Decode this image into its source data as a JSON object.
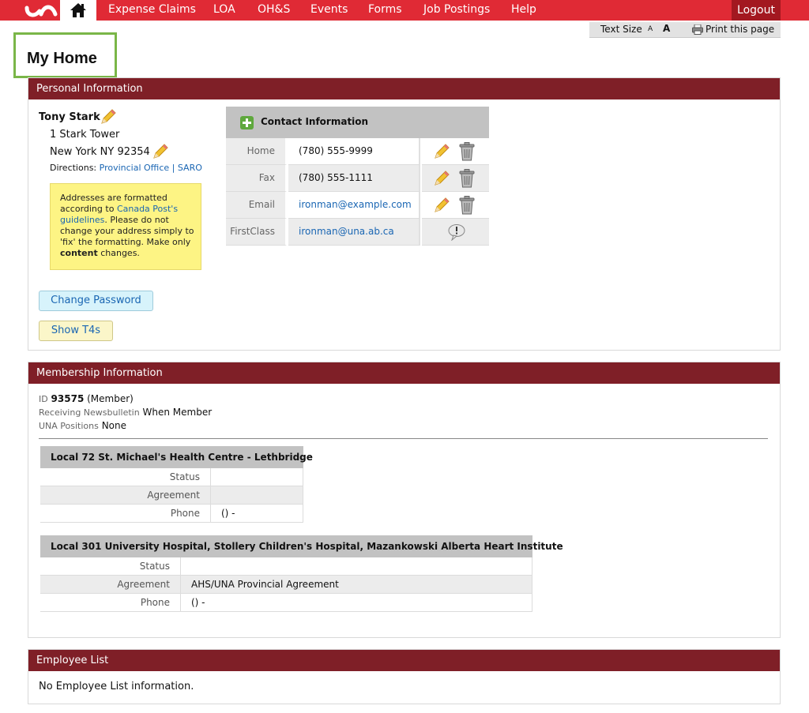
{
  "nav": {
    "home_label": "Home",
    "items": [
      "Expense Claims",
      "LOA",
      "OH&S",
      "Events",
      "Forms",
      "Job Postings",
      "Help"
    ],
    "logout": "Logout"
  },
  "toolbar": {
    "text_size": "Text Size",
    "small_a": "A",
    "large_a": "A",
    "print": "Print this page"
  },
  "page_title": "My Home",
  "personal": {
    "header": "Personal Information",
    "name": "Tony Stark",
    "address_line1": "1 Stark Tower",
    "address_line2": "New York NY 92354",
    "directions_label": "Directions:",
    "directions_links": [
      "Provincial Office",
      "SARO"
    ],
    "directions_sep": "|",
    "note": {
      "part1": "Addresses are formatted according to ",
      "link": "Canada Post's guidelines",
      "part2": ". Please do not change your address simply to 'fix' the formatting. Make only ",
      "bold": "content",
      "part3": " changes."
    },
    "change_password": "Change Password",
    "show_t4s": "Show T4s"
  },
  "contact": {
    "header": "Contact Information",
    "rows": [
      {
        "label": "Home",
        "value": "(780) 555-9999",
        "actions": [
          "pencil-icon",
          "trash-icon"
        ]
      },
      {
        "label": "Fax",
        "value": "(780) 555-1111",
        "actions": [
          "pencil-icon",
          "trash-icon"
        ]
      },
      {
        "label": "Email",
        "value": "ironman@example.com",
        "actions": [
          "pencil-icon",
          "trash-icon"
        ]
      },
      {
        "label": "FirstClass",
        "value": "ironman@una.ab.ca",
        "actions": [
          "info-bubble-icon"
        ]
      }
    ]
  },
  "membership": {
    "header": "Membership Information",
    "id_key": "ID",
    "id_value": "93575",
    "id_status": "(Member)",
    "newsbulletin_key": "Receiving Newsbulletin",
    "newsbulletin_value": "When Member",
    "positions_key": "UNA Positions",
    "positions_value": "None",
    "locals": [
      {
        "title": "Local 72 St. Michael's Health Centre - Lethbridge",
        "rows": [
          {
            "key": "Status",
            "value": ""
          },
          {
            "key": "Agreement",
            "value": ""
          },
          {
            "key": "Phone",
            "value": "() -"
          }
        ]
      },
      {
        "title": "Local 301 University Hospital, Stollery Children's Hospital, Mazankowski Alberta Heart Institute",
        "rows": [
          {
            "key": "Status",
            "value": ""
          },
          {
            "key": "Agreement",
            "value": "AHS/UNA Provincial Agreement"
          },
          {
            "key": "Phone",
            "value": "() -"
          }
        ]
      }
    ]
  },
  "employee": {
    "header": "Employee List",
    "message": "No Employee List information."
  },
  "colors": {
    "nav_red": "#e02a35",
    "logout_red": "#a31820",
    "panel_header": "#7f1f27",
    "title_outline": "#7ab648",
    "link_blue": "#1a66b3",
    "note_yellow": "#fdf484"
  }
}
